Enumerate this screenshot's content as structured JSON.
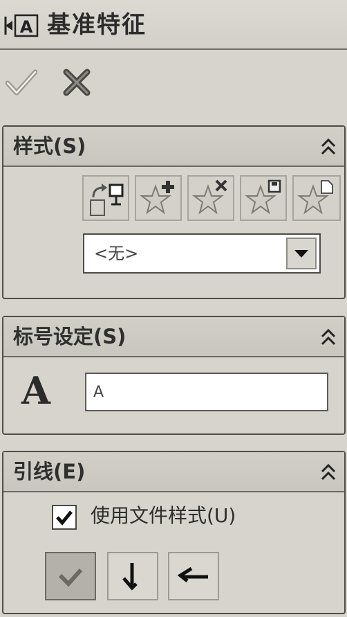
{
  "window": {
    "title": "基准特征",
    "icon": "datum-feature-icon"
  },
  "actions": {
    "ok_icon": "checkmark-icon",
    "cancel_icon": "close-icon"
  },
  "style_panel": {
    "title": "样式(S)",
    "collapse_icon": "double-chevron-up-icon",
    "toolbar": [
      "apply-default-style-icon",
      "add-style-icon",
      "delete-style-icon",
      "save-style-icon",
      "load-style-icon"
    ],
    "selected_style": "<无>",
    "dropdown_icon": "chevron-down-icon"
  },
  "label_panel": {
    "title": "标号设定(S)",
    "collapse_icon": "double-chevron-up-icon",
    "label_icon": "A",
    "label_value": "A"
  },
  "leader_panel": {
    "title": "引线(E)",
    "collapse_icon": "double-chevron-up-icon",
    "use_document_style_label": "使用文件样式(U)",
    "use_document_style_checked": true,
    "leader_buttons": [
      "leader-angled-icon",
      "leader-vertical-icon",
      "leader-horizontal-icon"
    ],
    "selected_leader": 0
  },
  "colors": {
    "background": "#d7d4ce",
    "border": "#4f4d49",
    "star": "#c8c5bd"
  }
}
